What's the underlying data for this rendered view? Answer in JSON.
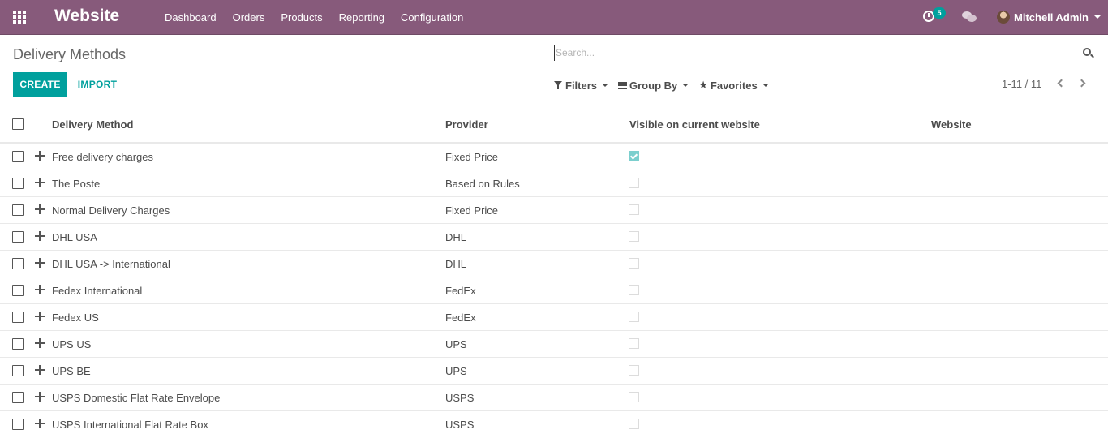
{
  "navbar": {
    "brand": "Website",
    "menu": [
      "Dashboard",
      "Orders",
      "Products",
      "Reporting",
      "Configuration"
    ],
    "activity_count": "5",
    "user_name": "Mitchell Admin",
    "bg_color": "#875a7b"
  },
  "control_panel": {
    "title": "Delivery Methods",
    "create_label": "CREATE",
    "import_label": "IMPORT",
    "search_placeholder": "Search...",
    "filters_label": "Filters",
    "group_by_label": "Group By",
    "favorites_label": "Favorites",
    "pager": "1-11 / 11",
    "accent_color": "#00a09d"
  },
  "table": {
    "headers": {
      "name": "Delivery Method",
      "provider": "Provider",
      "visible": "Visible on current website",
      "website": "Website"
    },
    "rows": [
      {
        "name": "Free delivery charges",
        "provider": "Fixed Price",
        "visible": true
      },
      {
        "name": "The Poste",
        "provider": "Based on Rules",
        "visible": false
      },
      {
        "name": "Normal Delivery Charges",
        "provider": "Fixed Price",
        "visible": false
      },
      {
        "name": "DHL USA",
        "provider": "DHL",
        "visible": false
      },
      {
        "name": "DHL USA -> International",
        "provider": "DHL",
        "visible": false
      },
      {
        "name": "Fedex International",
        "provider": "FedEx",
        "visible": false
      },
      {
        "name": "Fedex US",
        "provider": "FedEx",
        "visible": false
      },
      {
        "name": "UPS US",
        "provider": "UPS",
        "visible": false
      },
      {
        "name": "UPS BE",
        "provider": "UPS",
        "visible": false
      },
      {
        "name": "USPS Domestic Flat Rate Envelope",
        "provider": "USPS",
        "visible": false
      },
      {
        "name": "USPS International Flat Rate Box",
        "provider": "USPS",
        "visible": false
      }
    ]
  }
}
